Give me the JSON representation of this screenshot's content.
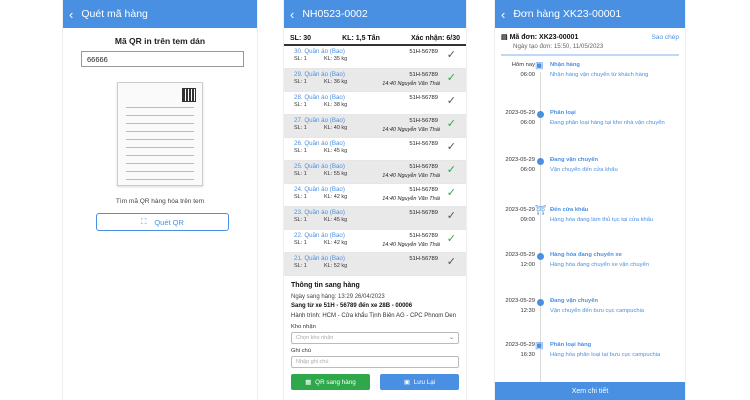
{
  "screen1": {
    "header_title": "Quét mã hàng",
    "qr_title": "Mã QR in trên tem dán",
    "qr_input_value": "66666",
    "hint": "Tìm mã QR hàng hóa trên tem",
    "scan_button": "Quét QR"
  },
  "screen2": {
    "header_title": "NH0523-0002",
    "sl": "SL: 30",
    "kl": "KL: 1,5 Tấn",
    "confirmed": "Xác nhận: 6/30",
    "items": [
      {
        "name": "30. Quần áo (Bao)",
        "sl": "SL: 1",
        "kl": "KL: 35 kg",
        "plate": "51H-56789",
        "who": "",
        "check": "black"
      },
      {
        "name": "29. Quần áo (Bao)",
        "sl": "SL: 1",
        "kl": "KL: 36 kg",
        "plate": "51H-56789",
        "who": "14:40  Nguyễn Văn Thái",
        "check": "green"
      },
      {
        "name": "28. Quần áo (Bao)",
        "sl": "SL: 1",
        "kl": "KL: 38 kg",
        "plate": "51H-56789",
        "who": "",
        "check": "black"
      },
      {
        "name": "27. Quần áo (Bao)",
        "sl": "SL: 1",
        "kl": "KL: 40 kg",
        "plate": "51H-56789",
        "who": "14:40  Nguyễn Văn Thái",
        "check": "green"
      },
      {
        "name": "26. Quần áo (Bao)",
        "sl": "SL: 1",
        "kl": "KL: 45 kg",
        "plate": "51H-56789",
        "who": "",
        "check": "black"
      },
      {
        "name": "25. Quần áo (Bao)",
        "sl": "SL: 1",
        "kl": "KL: 55 kg",
        "plate": "51H-56789",
        "who": "14:40  Nguyễn Văn Thái",
        "check": "green"
      },
      {
        "name": "24. Quần áo (Bao)",
        "sl": "SL: 1",
        "kl": "KL: 42 kg",
        "plate": "51H-56789",
        "who": "14:40  Nguyễn Văn Thái",
        "check": "green"
      },
      {
        "name": "23. Quần áo (Bao)",
        "sl": "SL: 1",
        "kl": "KL: 45 kg",
        "plate": "51H-56789",
        "who": "",
        "check": "black"
      },
      {
        "name": "22. Quần áo (Bao)",
        "sl": "SL: 1",
        "kl": "KL: 42 kg",
        "plate": "51H-56789",
        "who": "14:40  Nguyễn Văn Thái",
        "check": "green"
      },
      {
        "name": "21. Quần áo (Bao)",
        "sl": "SL: 1",
        "kl": "KL: 52 kg",
        "plate": "51H-56789",
        "who": "",
        "check": "black"
      }
    ],
    "info_title": "Thông tin sang hàng",
    "transfer_date": "Ngày sang hàng: 13:29 26/04/2023",
    "route": "Sang từ xe 51H - 56789 đến xe 28B - 00006",
    "journey": "Hành trình: HCM - Cửa khẩu Tịnh Biên AG - CPC Phnom Den",
    "warehouse_label": "Kho nhận",
    "warehouse_placeholder": "Chọn kho nhận",
    "note_label": "Ghi chú",
    "note_placeholder": "Nhập ghi chú",
    "qr_button": "QR sang hàng",
    "save_button": "Lưu Lại"
  },
  "screen3": {
    "header_title": "Đơn hàng XK23-00001",
    "order_code": "Mã đơn: XK23-00001",
    "copy": "Sao chép",
    "created": "Ngày tạo đơn: 15:50, 11/05/2023",
    "events": [
      {
        "date": "Hôm nay",
        "time": "06:00",
        "title": "Nhận hàng",
        "desc": "Nhận hàng vận chuyển từ khách hàng",
        "icon": "box-icon"
      },
      {
        "date": "2023-05-29",
        "time": "06:00",
        "title": "Phân loại",
        "desc": "Đang phân loại hàng tại kho nhà vận chuyển",
        "icon": "dot"
      },
      {
        "date": "2023-05-29",
        "time": "06:00",
        "title": "Đang vận chuyển",
        "desc": "Vận chuyển đến cửa khẩu",
        "icon": "dot"
      },
      {
        "date": "2023-05-29",
        "time": "09:00",
        "title": "Đến cửa khẩu",
        "desc": "Hàng hóa đang làm thủ tục tại cửa khẩu",
        "icon": "gate-icon"
      },
      {
        "date": "2023-05-29",
        "time": "12:00",
        "title": "Hàng hóa đang chuyển xe",
        "desc": "Hàng hóa đang chuyển xe vận chuyển",
        "icon": "dot"
      },
      {
        "date": "2023-05-29",
        "time": "12:30",
        "title": "Đang vận chuyển",
        "desc": "Vận chuyển đến bưu cục campuchia",
        "icon": "dot"
      },
      {
        "date": "2023-05-29",
        "time": "16:30",
        "title": "Phân loại hàng",
        "desc": "Hàng hóa phân loại tại bưu cục campuchia",
        "icon": "box-icon"
      }
    ],
    "footer": "Xem chi tiết"
  }
}
